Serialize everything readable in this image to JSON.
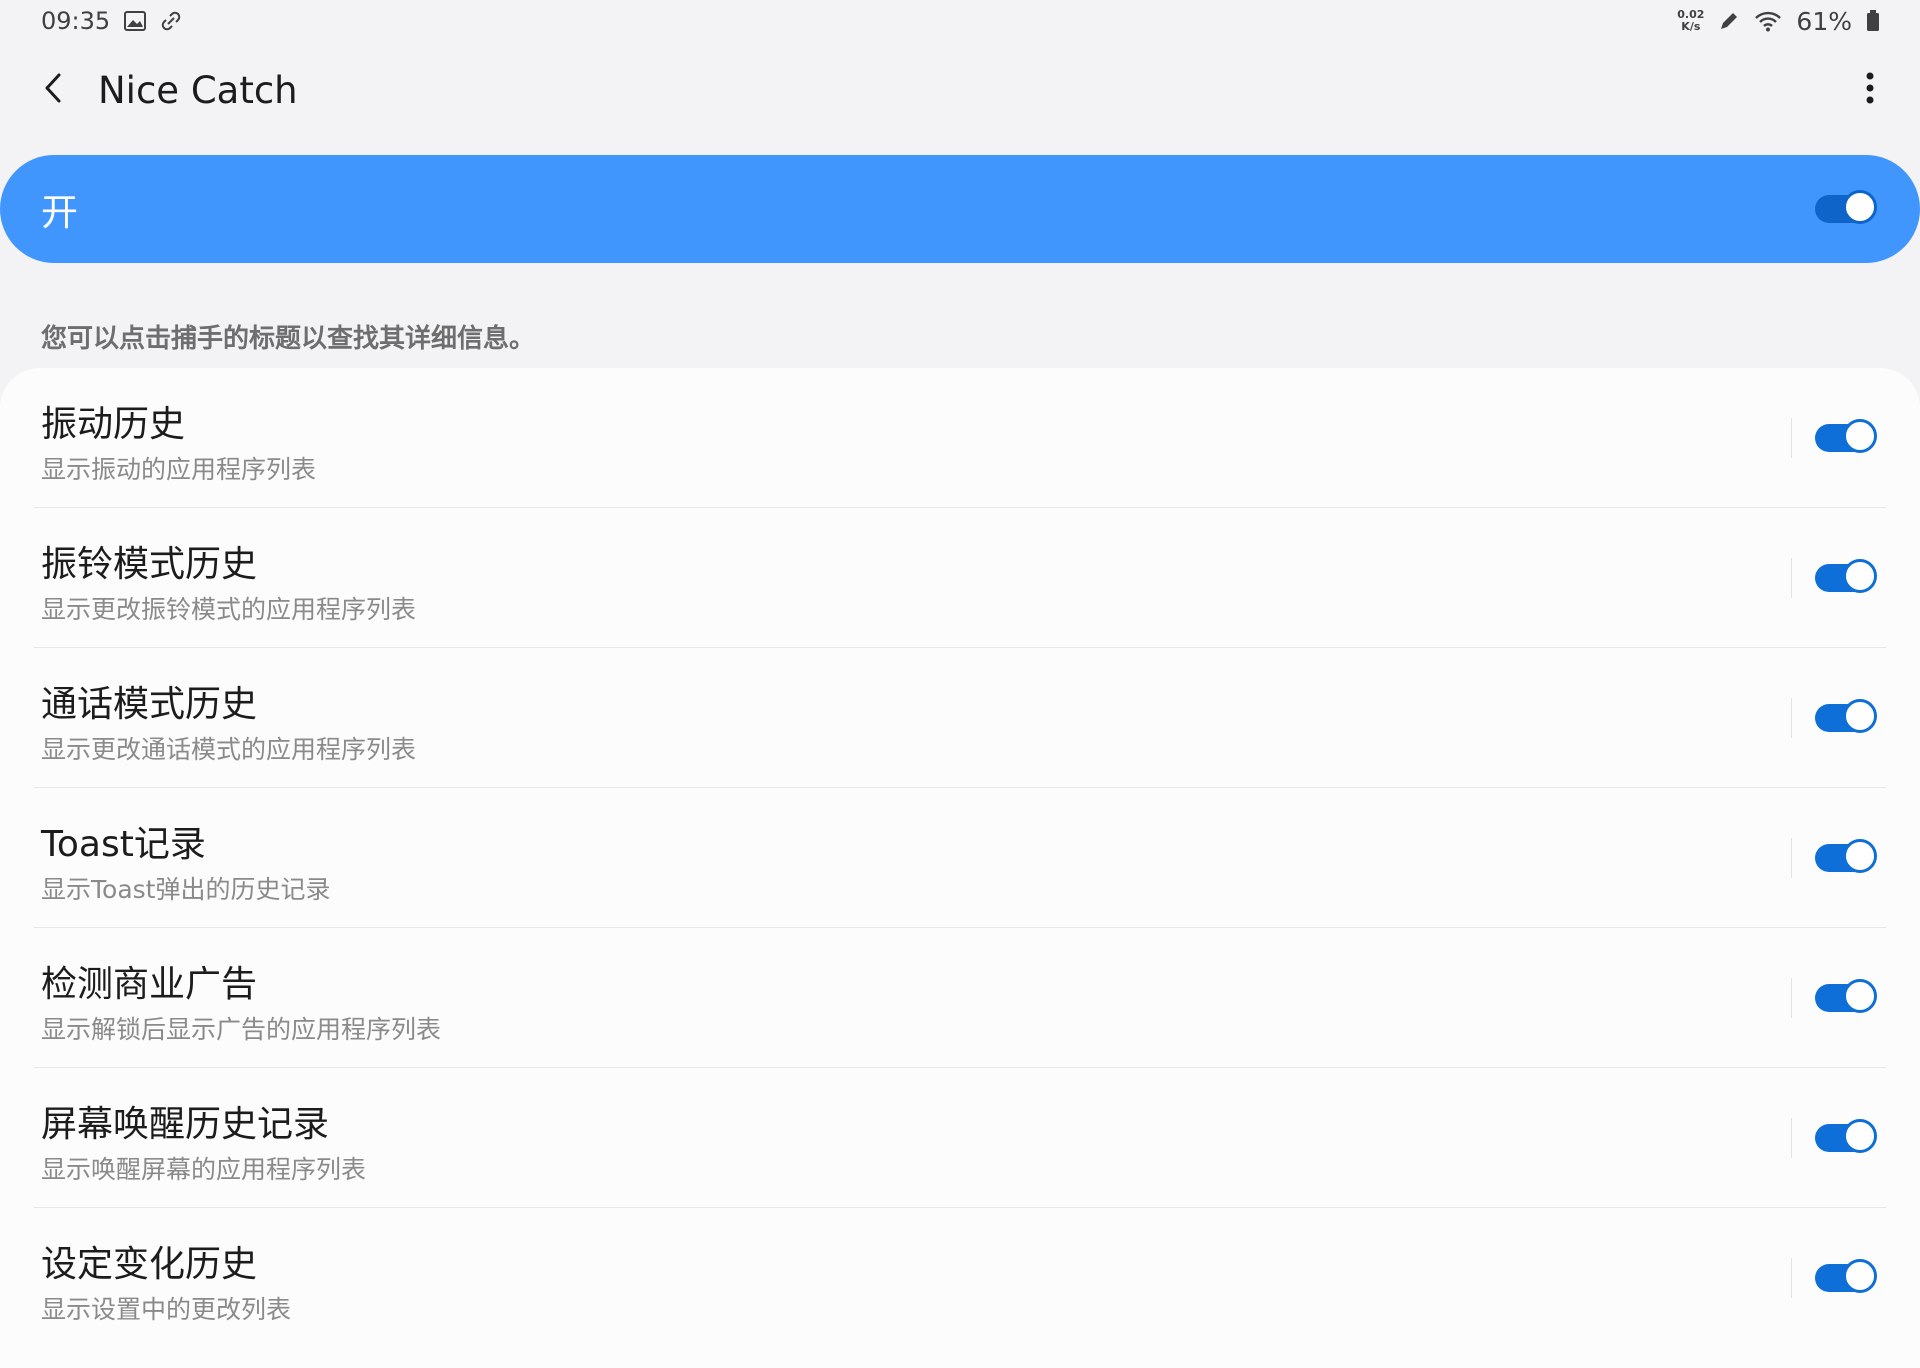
{
  "status_bar": {
    "time": "09:35",
    "net_speed_value": "0.02",
    "net_speed_unit": "K/s",
    "battery": "61%"
  },
  "app_bar": {
    "title": "Nice Catch"
  },
  "master_switch": {
    "label": "开",
    "on": true
  },
  "description": "您可以点击捕手的标题以查找其详细信息。",
  "items": [
    {
      "title": "振动历史",
      "subtitle": "显示振动的应用程序列表",
      "on": true
    },
    {
      "title": "振铃模式历史",
      "subtitle": "显示更改振铃模式的应用程序列表",
      "on": true
    },
    {
      "title": "通话模式历史",
      "subtitle": "显示更改通话模式的应用程序列表",
      "on": true
    },
    {
      "title": "Toast记录",
      "subtitle": "显示Toast弹出的历史记录",
      "on": true
    },
    {
      "title": "检测商业广告",
      "subtitle": "显示解锁后显示广告的应用程序列表",
      "on": true
    },
    {
      "title": "屏幕唤醒历史记录",
      "subtitle": "显示唤醒屏幕的应用程序列表",
      "on": true
    },
    {
      "title": "设定变化历史",
      "subtitle": "显示设置中的更改列表",
      "on": true
    }
  ],
  "colors": {
    "accent": "#4096fd",
    "toggle_on": "#0f6fd8",
    "background": "#f3f3f5",
    "card": "#fcfcfc"
  },
  "icons": {
    "back": "back-arrow-icon",
    "more": "more-vertical-icon",
    "gallery": "image-icon",
    "link": "link-icon",
    "pen": "pen-icon",
    "wifi": "wifi-icon",
    "battery": "battery-icon"
  }
}
